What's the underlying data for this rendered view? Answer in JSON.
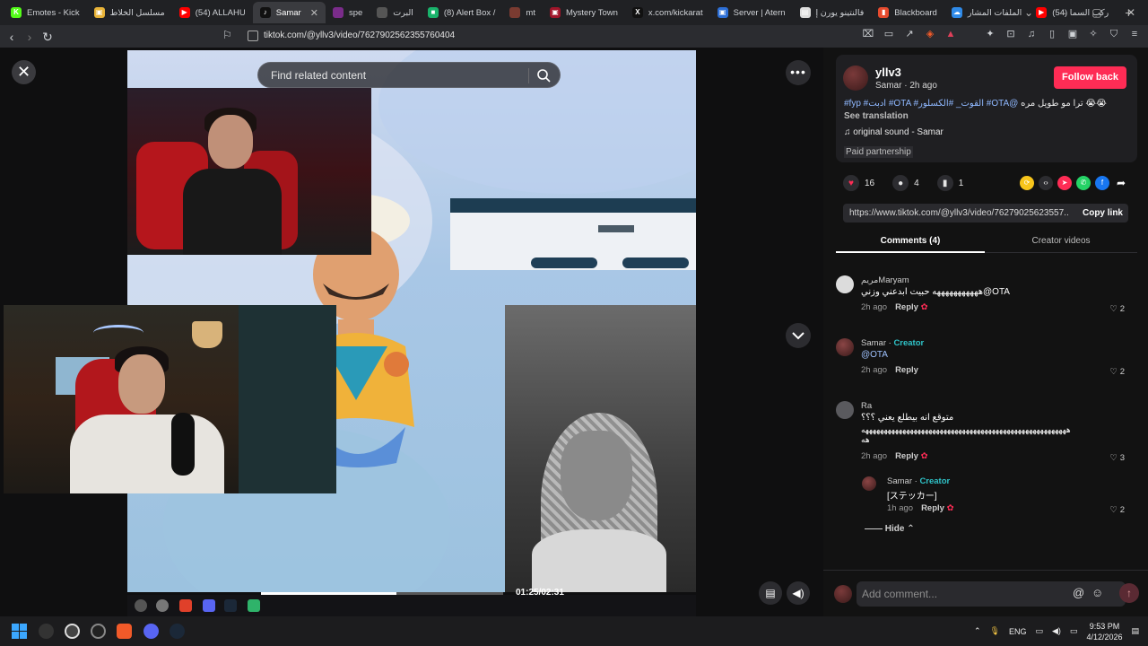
{
  "browser": {
    "tabs": [
      {
        "label": "Emotes - Kick",
        "color": "#53fc18",
        "glyph": "K"
      },
      {
        "label": "مسلسل الخلاط",
        "color": "#e8b338",
        "glyph": "▣"
      },
      {
        "label": "(54) ALLAHU",
        "color": "#ff0000",
        "glyph": "▶"
      },
      {
        "label": "Samar",
        "color": "#111111",
        "glyph": "♪",
        "active": true
      },
      {
        "label": "spe",
        "color": "#7a2c8a",
        "glyph": ""
      },
      {
        "label": "البرت",
        "color": "#555555",
        "glyph": ""
      },
      {
        "label": "(8) Alert Box /",
        "color": "#19b36b",
        "glyph": "■"
      },
      {
        "label": "mt",
        "color": "#7a3b31",
        "glyph": ""
      },
      {
        "label": "Mystery Town",
        "color": "#a0152a",
        "glyph": "▣"
      },
      {
        "label": "x.com/kickarat",
        "color": "#111111",
        "glyph": "X"
      },
      {
        "label": "Server | Atern",
        "color": "#2d6fd6",
        "glyph": "▣"
      },
      {
        "label": "فالنتينو يورن إ",
        "color": "#dddddd",
        "glyph": "▤"
      },
      {
        "label": "Blackboard",
        "color": "#e64b2e",
        "glyph": "▮"
      },
      {
        "label": "الملفات المشار",
        "color": "#2f8ae8",
        "glyph": "☁"
      },
      {
        "label": "(54) ركب السما",
        "color": "#ff0000",
        "glyph": "▶"
      }
    ],
    "url": "tiktok.com/@yllv3/video/7627902562355760404"
  },
  "player": {
    "search_placeholder": "Find related content",
    "time": "01:25/02:31",
    "progress_fraction": 0.56
  },
  "post": {
    "author": "yllv3",
    "author_sub": "Samar · 2h ago",
    "follow_label": "Follow back",
    "caption_text": "ترا مو طويل مره 😭😭",
    "caption_tags": "#fyp #ادبت #OTA #القوت_ #الكسلور #OTA@",
    "see_translation": "See translation",
    "sound": "original sound - Samar",
    "paid": "Paid partnership",
    "likes": "16",
    "comments": "4",
    "saves": "1",
    "link": "https://www.tiktok.com/@yllv3/video/76279025623557...",
    "copy_link": "Copy link",
    "tab_comments": "Comments (4)",
    "tab_creator": "Creator videos"
  },
  "comments": [
    {
      "name": "مريمMaryam",
      "body": "هههههههههههه حبيت ابدعني وزني@OTA",
      "time": "2h ago",
      "reply": "Reply",
      "likes": "2"
    },
    {
      "name": "Samar",
      "creator": "Creator",
      "body": "@OTA",
      "time": "2h ago",
      "reply": "Reply",
      "likes": "2"
    },
    {
      "name": "Ra",
      "body": "متوقع انه بيطلع يعني ؟؟؟",
      "body2": "هههههههههههههههههههههههههههههههههههههههههههههههههههههههه",
      "body3": "هه",
      "time": "2h ago",
      "reply": "Reply",
      "likes": "3"
    },
    {
      "name": "Samar",
      "creator": "Creator",
      "body": "[ステッカー]",
      "time": "1h ago",
      "reply": "Reply",
      "likes": "2"
    }
  ],
  "hide_label": "Hide",
  "add_comment_placeholder": "Add comment...",
  "system": {
    "lang": "ENG",
    "time": "9:53 PM",
    "date": "4/12/2026"
  },
  "colors": {
    "accent": "#fe2c55",
    "creator": "#2fc3c8"
  }
}
